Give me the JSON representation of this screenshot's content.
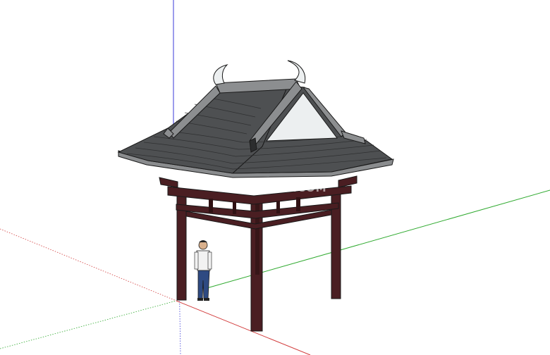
{
  "viewport": {
    "background": "#ffffff",
    "axis_colors": {
      "red": "#d23c3c",
      "green": "#2faa2f",
      "blue": "#3a3ad8"
    }
  },
  "model": {
    "subject": "pavilion-with-figure",
    "colors": {
      "tile": "#4e5052",
      "tile_line": "#2c2d2e",
      "ridge": "#8c8e90",
      "gable": "#eceff0",
      "wood": "#4a1e22",
      "wood_dark": "#2f1214",
      "outline": "#1a1a1a"
    }
  },
  "figure": {
    "shirt": "#f2f2f2",
    "pants": "#2e4a82",
    "skin": "#d9b08c"
  },
  "watermark": {
    "text": "COI88.COM"
  }
}
